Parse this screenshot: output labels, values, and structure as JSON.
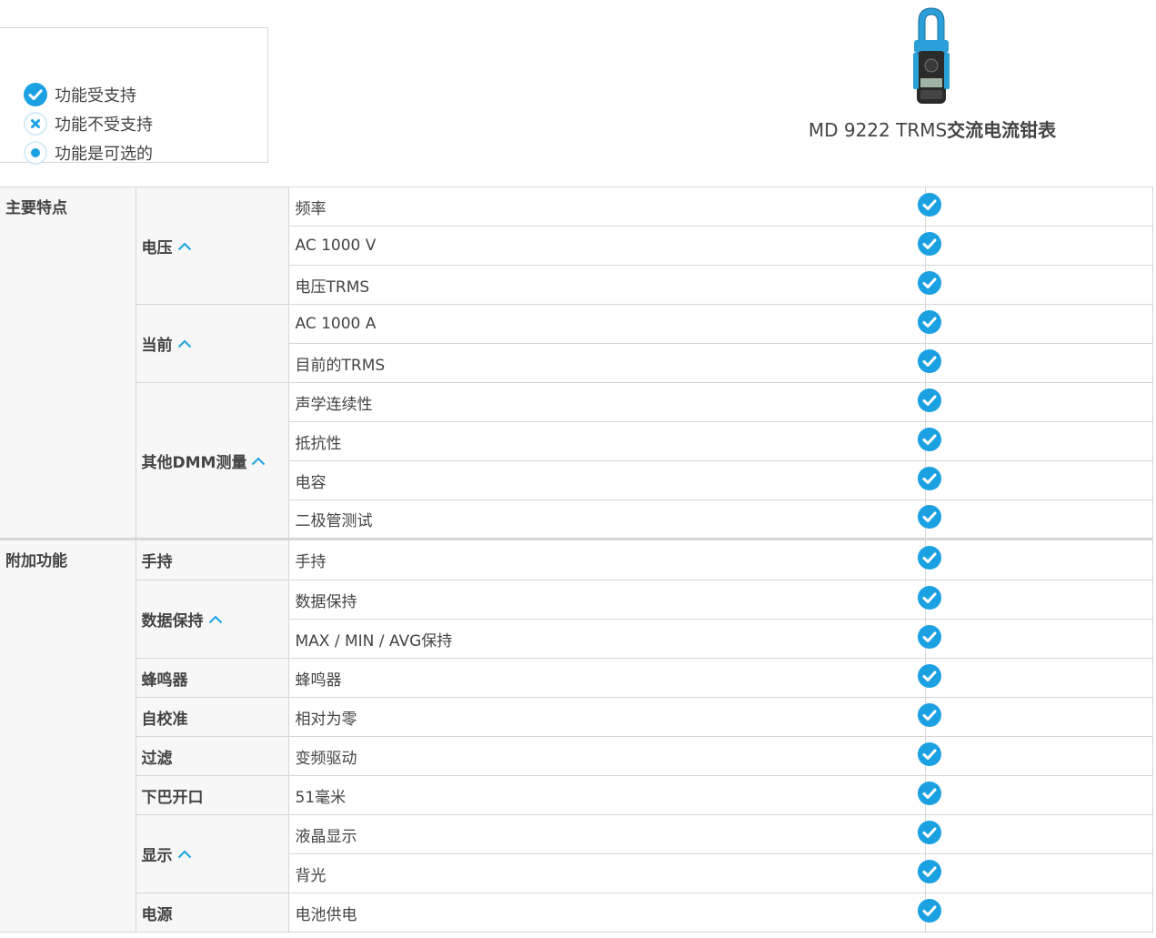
{
  "colors": {
    "accent": "#1ba1e2",
    "text": "#444444",
    "border": "#d6d6d6",
    "rowshade": "#f7f7f7"
  },
  "legend": {
    "supported": "功能受支持",
    "not_supported": "功能不受支持",
    "optional": "功能是可选的"
  },
  "product": {
    "name_prefix": "MD 9222 TRMS",
    "name_suffix": "交流电流钳表",
    "image_icon": "clamp-meter-image"
  },
  "sections": {
    "main": "主要特点",
    "extra": "附加功能"
  },
  "groups": {
    "voltage": "电压",
    "current": "当前",
    "other_dmm": "其他DMM测量",
    "handheld": "手持",
    "data_hold": "数据保持",
    "buzzer": "蜂鸣器",
    "self_cal": "自校准",
    "filter": "过滤",
    "jaw": "下巴开口",
    "display": "显示",
    "power": "电源"
  },
  "features": {
    "frequency": "频率",
    "ac_v": "AC 1000 V",
    "v_trms": "电压TRMS",
    "ac_a": "AC 1000 A",
    "a_trms": "目前的TRMS",
    "continuity": "声学连续性",
    "resistance": "抵抗性",
    "capacitance": "电容",
    "diode": "二极管测试",
    "handheld": "手持",
    "data_hold": "数据保持",
    "max_min_avg": "MAX / MIN / AVG保持",
    "buzzer": "蜂鸣器",
    "relative_zero": "相对为零",
    "vfd": "变频驱动",
    "jaw_51": "51毫米",
    "lcd": "液晶显示",
    "backlight": "背光",
    "battery": "电池供电"
  },
  "status_icon": "check-circle-icon"
}
